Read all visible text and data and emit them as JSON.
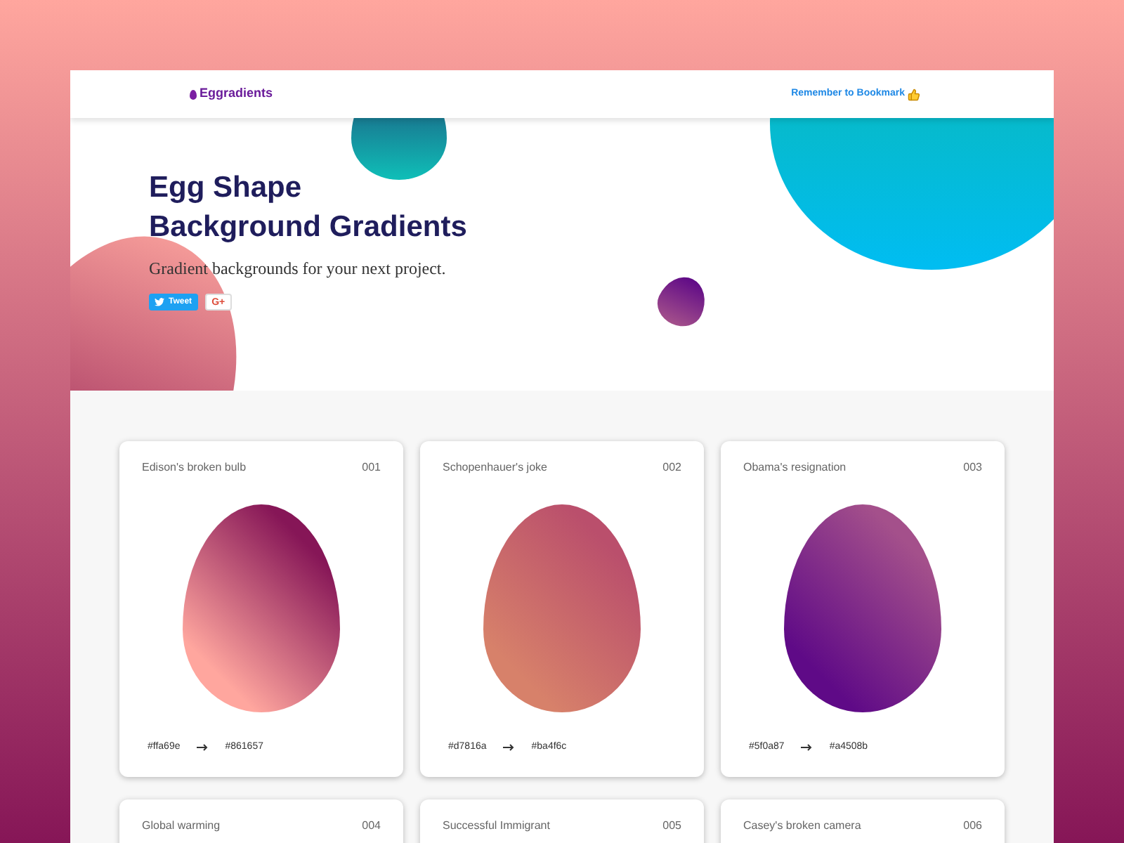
{
  "nav": {
    "brand": "Eggradients",
    "bookmark": "Remember to Bookmark"
  },
  "hero": {
    "title_lines": [
      "Egg Shape",
      "Background Gradients"
    ],
    "subtitle": "Gradient backgrounds for your next project.",
    "tweet_label": "Tweet",
    "gplus_label": "G+"
  },
  "cards": [
    {
      "name": "Edison's broken bulb",
      "number": "001",
      "color": "#ffa69e",
      "color_to": "#861657"
    },
    {
      "name": "Schopenhauer's joke",
      "number": "002",
      "color": "#d7816a",
      "color_to": "#ba4f6c"
    },
    {
      "name": "Obama's resignation",
      "number": "003",
      "color": "#5f0a87",
      "color_to": "#a4508b"
    },
    {
      "name": "Global warming",
      "number": "004"
    },
    {
      "name": "Successful Immigrant",
      "number": "005"
    },
    {
      "name": "Casey's broken camera",
      "number": "006"
    }
  ]
}
